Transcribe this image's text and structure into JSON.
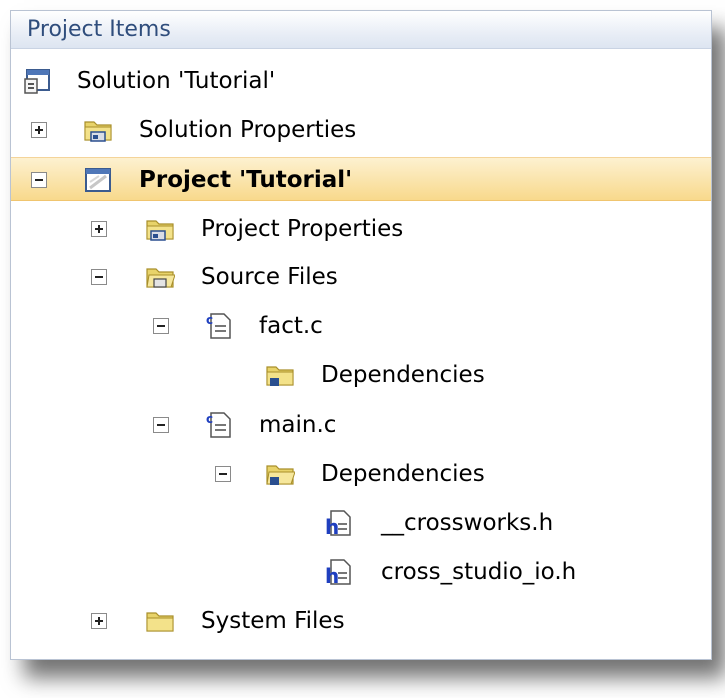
{
  "panel": {
    "title": "Project Items"
  },
  "tree": {
    "solution": "Solution 'Tutorial'",
    "solution_properties": "Solution Properties",
    "project": "Project 'Tutorial'",
    "project_properties": "Project Properties",
    "source_files": "Source Files",
    "fact_c": "fact.c",
    "fact_dependencies": "Dependencies",
    "main_c": "main.c",
    "main_dependencies": "Dependencies",
    "crossworks_h": "__crossworks.h",
    "cross_studio_io_h": "cross_studio_io.h",
    "system_files": "System Files"
  },
  "colors": {
    "header_text": "#2f4d7c",
    "selection": "#f8d98c",
    "folder": "#e8d36a"
  }
}
